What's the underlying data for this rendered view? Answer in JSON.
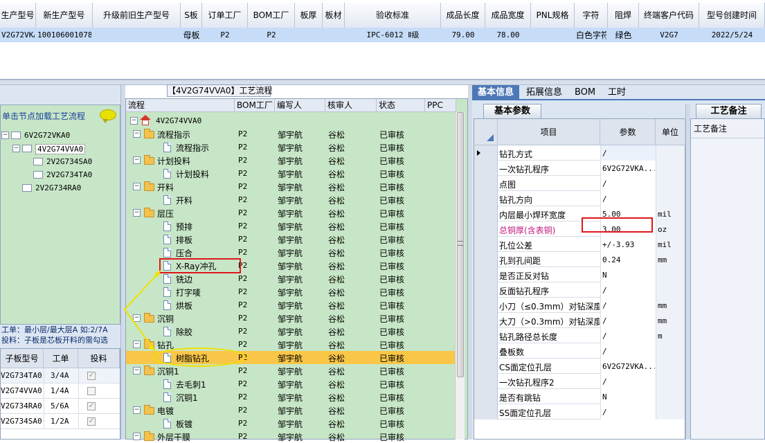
{
  "top_table": {
    "headers": [
      "生产型号",
      "新生产型号",
      "升级前旧生产型号",
      "S板",
      "订单工厂",
      "BOM工厂",
      "板厚",
      "板材",
      "验收标准",
      "成品长度",
      "成品宽度",
      "PNL规格",
      "字符",
      "阻焊",
      "终端客户代码",
      "型号创建时间"
    ],
    "row": [
      "V2G72VKA0",
      "10010600107888",
      "",
      "母板",
      "P2",
      "P2",
      "",
      "",
      "IPC-6012 Ⅱ级",
      "79.00",
      "78.00",
      "",
      "白色字符",
      "绿色",
      "V2G7",
      "2022/5/24"
    ]
  },
  "process_title": "【4V2G74VVA0】工艺流程",
  "left_panel": {
    "hint": "单击节点加载工艺流程",
    "tree": [
      {
        "label": "6V2G72VKA0",
        "level": 0,
        "expander": "−"
      },
      {
        "label": "4V2G74VVA0",
        "level": 1,
        "expander": "−"
      },
      {
        "label": "2V2G734SA0",
        "level": 2,
        "expander": ""
      },
      {
        "label": "2V2G734TA0",
        "level": 2,
        "expander": ""
      },
      {
        "label": "2V2G734RA0",
        "level": 1,
        "expander": ""
      }
    ],
    "note1": "工单：最小层/最大层A 如:2/7A",
    "note2": "投料：子板是芯板开料的需勾选",
    "table_headers": [
      "子板型号",
      "工单",
      "投料"
    ],
    "table_rows": [
      {
        "model": "V2G734TA0",
        "order": "3/4A",
        "checked": true
      },
      {
        "model": "V2G74VVA0",
        "order": "1/4A",
        "checked": false
      },
      {
        "model": "V2G734RA0",
        "order": "5/6A",
        "checked": true
      },
      {
        "model": "V2G734SA0",
        "order": "1/2A",
        "checked": true
      }
    ]
  },
  "flow_grid": {
    "headers": [
      "流程",
      "BOM工厂",
      "编写人",
      "核审人",
      "状态",
      "PPC"
    ],
    "root": "4V2G74VVA0",
    "rows": [
      {
        "label": "流程指示",
        "type": "folder",
        "factory": "P2",
        "writer": "邹宇航",
        "checker": "谷松",
        "status": "已审核"
      },
      {
        "label": "流程指示",
        "type": "doc",
        "factory": "P2",
        "writer": "邹宇航",
        "checker": "谷松",
        "status": "已审核"
      },
      {
        "label": "计划投料",
        "type": "folder",
        "factory": "P2",
        "writer": "邹宇航",
        "checker": "谷松",
        "status": "已审核"
      },
      {
        "label": "计划投料",
        "type": "doc",
        "factory": "P2",
        "writer": "邹宇航",
        "checker": "谷松",
        "status": "已审核"
      },
      {
        "label": "开料",
        "type": "folder",
        "factory": "P2",
        "writer": "邹宇航",
        "checker": "谷松",
        "status": "已审核"
      },
      {
        "label": "开料",
        "type": "doc",
        "factory": "P2",
        "writer": "邹宇航",
        "checker": "谷松",
        "status": "已审核"
      },
      {
        "label": "层压",
        "type": "folder",
        "factory": "P2",
        "writer": "邹宇航",
        "checker": "谷松",
        "status": "已审核"
      },
      {
        "label": "预排",
        "type": "doc",
        "factory": "P2",
        "writer": "邹宇航",
        "checker": "谷松",
        "status": "已审核"
      },
      {
        "label": "排板",
        "type": "doc",
        "factory": "P2",
        "writer": "邹宇航",
        "checker": "谷松",
        "status": "已审核"
      },
      {
        "label": "压合",
        "type": "doc",
        "factory": "P2",
        "writer": "邹宇航",
        "checker": "谷松",
        "status": "已审核"
      },
      {
        "label": "X-Ray冲孔",
        "type": "doc",
        "factory": "P2",
        "writer": "邹宇航",
        "checker": "谷松",
        "status": "已审核"
      },
      {
        "label": "铣边",
        "type": "doc",
        "factory": "P2",
        "writer": "邹宇航",
        "checker": "谷松",
        "status": "已审核"
      },
      {
        "label": "打字唛",
        "type": "doc",
        "factory": "P2",
        "writer": "邹宇航",
        "checker": "谷松",
        "status": "已审核"
      },
      {
        "label": "烘板",
        "type": "doc",
        "factory": "P2",
        "writer": "邹宇航",
        "checker": "谷松",
        "status": "已审核"
      },
      {
        "label": "沉铜",
        "type": "folder",
        "factory": "P2",
        "writer": "邹宇航",
        "checker": "谷松",
        "status": "已审核"
      },
      {
        "label": "除胶",
        "type": "doc",
        "factory": "P2",
        "writer": "邹宇航",
        "checker": "谷松",
        "status": "已审核"
      },
      {
        "label": "钻孔",
        "type": "folder",
        "factory": "P2",
        "writer": "邹宇航",
        "checker": "谷松",
        "status": "已审核"
      },
      {
        "label": "树脂钻孔",
        "type": "doc",
        "factory": "P2",
        "writer": "邹宇航",
        "checker": "谷松",
        "status": "已审核"
      },
      {
        "label": "沉铜1",
        "type": "folder",
        "factory": "P2",
        "writer": "邹宇航",
        "checker": "谷松",
        "status": "已审核"
      },
      {
        "label": "去毛刺1",
        "type": "doc",
        "factory": "P2",
        "writer": "邹宇航",
        "checker": "谷松",
        "status": "已审核"
      },
      {
        "label": "沉铜1",
        "type": "doc",
        "factory": "P2",
        "writer": "邹宇航",
        "checker": "谷松",
        "status": "已审核"
      },
      {
        "label": "电镀",
        "type": "folder",
        "factory": "P2",
        "writer": "邹宇航",
        "checker": "谷松",
        "status": "已审核"
      },
      {
        "label": "板镀",
        "type": "doc",
        "factory": "P2",
        "writer": "邹宇航",
        "checker": "谷松",
        "status": "已审核"
      },
      {
        "label": "外层干膜",
        "type": "folder",
        "factory": "P2",
        "writer": "邹宇航",
        "checker": "谷松",
        "status": "已审核"
      }
    ]
  },
  "right_tabs": [
    "基本信息",
    "拓展信息",
    "BOM",
    "工时"
  ],
  "basic_params": {
    "subtab": "基本参数",
    "headers": [
      "项目",
      "参数",
      "单位"
    ],
    "rows": [
      {
        "item": "钻孔方式",
        "value": "/",
        "unit": ""
      },
      {
        "item": "一次钻孔程序",
        "value": "6V2G72VKA...",
        "unit": ""
      },
      {
        "item": "点图",
        "value": "/",
        "unit": ""
      },
      {
        "item": "钻孔方向",
        "value": "/",
        "unit": ""
      },
      {
        "item": "内层最小焊环宽度",
        "value": "5.00",
        "unit": "mil"
      },
      {
        "item": "总铜厚(含表铜)",
        "value": "3.00",
        "unit": "oz"
      },
      {
        "item": "孔位公差",
        "value": "+/-3.93",
        "unit": "mil"
      },
      {
        "item": "孔到孔间距",
        "value": "0.24",
        "unit": "mm"
      },
      {
        "item": "是否正反对钻",
        "value": "N",
        "unit": ""
      },
      {
        "item": "反面钻孔程序",
        "value": "/",
        "unit": ""
      },
      {
        "item": "小刀（≤0.3mm）对钻深度",
        "value": "/",
        "unit": "mm"
      },
      {
        "item": "大刀（>0.3mm）对钻深度",
        "value": "/",
        "unit": "mm"
      },
      {
        "item": "钻孔路径总长度",
        "value": "/",
        "unit": "m"
      },
      {
        "item": "叠板数",
        "value": "/",
        "unit": ""
      },
      {
        "item": "CS面定位孔层",
        "value": "6V2G72VKA...",
        "unit": ""
      },
      {
        "item": "一次钻孔程序2",
        "value": "/",
        "unit": ""
      },
      {
        "item": "是否有跳钻",
        "value": "N",
        "unit": ""
      },
      {
        "item": "SS面定位孔层",
        "value": "/",
        "unit": ""
      }
    ]
  },
  "remarks": {
    "tab": "工艺备注",
    "header": "工艺备注"
  },
  "colors": {
    "tree_bg": "#c7e6c7",
    "highlight_row": "#f9c647",
    "red_box": "#e0161b",
    "yellow_annot": "#f0e000",
    "pink_text": "#c2187d"
  }
}
